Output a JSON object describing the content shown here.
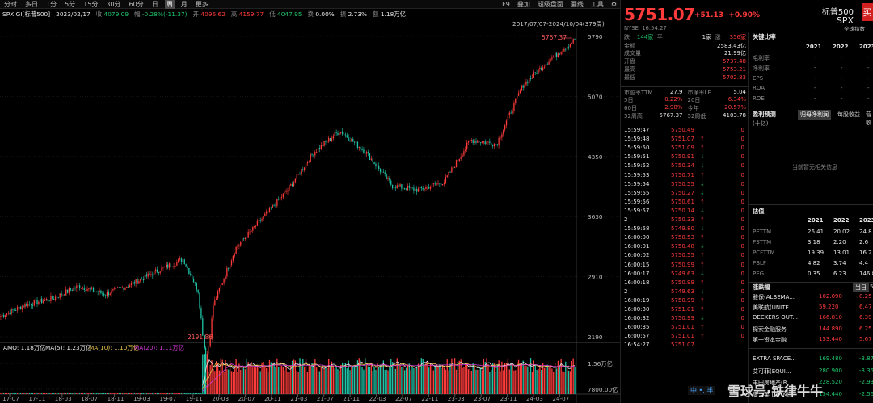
{
  "topbar": {
    "periods": [
      "分时",
      "多日",
      "1分",
      "5分",
      "15分",
      "30分",
      "60分",
      "日",
      "周",
      "月",
      "更多"
    ],
    "active_period": "周",
    "right_items": [
      "F9",
      "叠加",
      "超级盘面",
      "画线",
      "工具",
      "⚙"
    ]
  },
  "infobar": {
    "symbol": "SPX.GI[标普500]",
    "date": "2023/02/17",
    "close_label": "收",
    "close": "4079.09",
    "change_label": "幅",
    "change": "-0.28%(-11.37)",
    "open_label": "开",
    "open": "4096.62",
    "high_label": "高",
    "high": "4159.77",
    "low_label": "低",
    "low": "4047.95",
    "turnover_label": "换",
    "turnover": "0.00%",
    "amp_label": "振",
    "amp": "2.73%",
    "amount_label": "额",
    "amount": "1.18万亿"
  },
  "range": "2017/07/07-2024/10/04(379周)",
  "chart": {
    "price_axis": [
      "5790",
      "5070",
      "4350",
      "3630",
      "2910",
      "2190"
    ],
    "max_label": "5767.37",
    "min_label": "2191.86",
    "vol_axis": [
      "1.56万亿",
      "7800.00亿"
    ],
    "x_labels": [
      "17-07",
      "17-11",
      "18-03",
      "18-07",
      "18-11",
      "19-03",
      "19-07",
      "19-11",
      "20-03",
      "20-07",
      "20-11",
      "21-03",
      "21-07",
      "21-11",
      "22-03",
      "22-07",
      "22-11",
      "23-03",
      "23-07",
      "23-11",
      "24-03",
      "24-07"
    ],
    "vol_legend": {
      "amo": "AMO: 1.18万亿",
      "ma5": "MA(5): 1.23万亿",
      "ma10": "MA(10): 1.10万亿",
      "ma20": "MA(20): 1.11万亿"
    },
    "colors": {
      "up": "#ff3b3b",
      "down": "#1ec4a8",
      "ma5": "#e8e8e8",
      "ma10": "#e6c34a",
      "ma20": "#d23ad2"
    }
  },
  "chart_data": {
    "type": "candlestick",
    "series": [
      {
        "name": "SPX weekly close (approx)",
        "x": [
          "17-07",
          "17-11",
          "18-03",
          "18-07",
          "18-11",
          "19-03",
          "19-07",
          "19-11",
          "20-03",
          "20-07",
          "20-11",
          "21-03",
          "21-07",
          "21-11",
          "22-03",
          "22-07",
          "22-11",
          "23-03",
          "23-07",
          "23-11",
          "24-03",
          "24-07",
          "24-10"
        ],
        "values": [
          2440,
          2580,
          2650,
          2800,
          2700,
          2820,
          2980,
          3120,
          2450,
          3250,
          3600,
          3950,
          4400,
          4660,
          4400,
          4000,
          3950,
          4050,
          4550,
          4500,
          5200,
          5500,
          5751
        ]
      }
    ],
    "ylim": [
      2190,
      5790
    ]
  },
  "quote": {
    "price": "5751.07",
    "change": "+51.13",
    "pct": "+0.90%",
    "name": "标普500",
    "code": "SPX",
    "buy": "买",
    "index_label": "全球指数",
    "exchange": "NYSE",
    "time": "16:54:27",
    "breadth": {
      "up_label": "跌",
      "up": "144家",
      "flat_label": "平",
      "flat": "1家",
      "down_label": "涨",
      "down": "356家"
    },
    "rows": [
      {
        "k": "金额",
        "v": "2583.43亿",
        "c": "white"
      },
      {
        "k": "成交量",
        "v": "21.99亿",
        "c": "white"
      },
      {
        "k": "开盘",
        "v": "5737.48",
        "c": "red"
      },
      {
        "k": "最高",
        "v": "5753.21",
        "c": "red"
      },
      {
        "k": "最低",
        "v": "5702.83",
        "c": "red"
      }
    ],
    "val_rows": [
      {
        "k1": "市盈率TTM",
        "v1": "27.9",
        "k2": "市净率LF",
        "v2": "5.04",
        "c1": "white",
        "c2": "white"
      },
      {
        "k1": "5日",
        "v1": "0.22%",
        "k2": "20日",
        "v2": "6.34%",
        "c1": "red",
        "c2": "red"
      },
      {
        "k1": "60日",
        "v1": "2.98%",
        "k2": "今年",
        "v2": "20.57%",
        "c1": "red",
        "c2": "red"
      },
      {
        "k1": "52周高",
        "v1": "5767.37",
        "k2": "52周低",
        "v2": "4103.78",
        "c1": "white",
        "c2": "white"
      }
    ],
    "ticks": [
      {
        "t": "15:59:47",
        "p": "5750.49",
        "a": "",
        "v": "0",
        "c": "red"
      },
      {
        "t": "15:59:48",
        "p": "5751.07",
        "a": "↑",
        "v": "0",
        "c": "red"
      },
      {
        "t": "15:59:50",
        "p": "5751.09",
        "a": "↑",
        "v": "0",
        "c": "red"
      },
      {
        "t": "15:59:51",
        "p": "5750.91",
        "a": "↓",
        "v": "0",
        "c": "red"
      },
      {
        "t": "15:59:52",
        "p": "5750.34",
        "a": "↓",
        "v": "0",
        "c": "red"
      },
      {
        "t": "15:59:53",
        "p": "5750.71",
        "a": "↑",
        "v": "0",
        "c": "red"
      },
      {
        "t": "15:59:54",
        "p": "5750.55",
        "a": "↓",
        "v": "0",
        "c": "red"
      },
      {
        "t": "15:59:55",
        "p": "5750.27",
        "a": "↓",
        "v": "0",
        "c": "red"
      },
      {
        "t": "15:59:56",
        "p": "5750.61",
        "a": "↑",
        "v": "0",
        "c": "red"
      },
      {
        "t": "15:59:57",
        "p": "5750.14",
        "a": "↓",
        "v": "0",
        "c": "red"
      },
      {
        "t": "2",
        "p": "5750.33",
        "a": "↑",
        "v": "0",
        "c": "red"
      },
      {
        "t": "15:59:58",
        "p": "5749.80",
        "a": "↓",
        "v": "0",
        "c": "red"
      },
      {
        "t": "16:00:00",
        "p": "5750.53",
        "a": "↑",
        "v": "0",
        "c": "red"
      },
      {
        "t": "16:00:01",
        "p": "5750.48",
        "a": "↓",
        "v": "0",
        "c": "red"
      },
      {
        "t": "16:00:02",
        "p": "5750.55",
        "a": "↑",
        "v": "0",
        "c": "red"
      },
      {
        "t": "16:00:15",
        "p": "5750.99",
        "a": "↑",
        "v": "0",
        "c": "red"
      },
      {
        "t": "16:00:17",
        "p": "5749.63",
        "a": "↓",
        "v": "0",
        "c": "red"
      },
      {
        "t": "16:00:18",
        "p": "5750.99",
        "a": "↑",
        "v": "0",
        "c": "red"
      },
      {
        "t": "2",
        "p": "5749.63",
        "a": "↓",
        "v": "0",
        "c": "red"
      },
      {
        "t": "16:00:19",
        "p": "5750.99",
        "a": "↑",
        "v": "0",
        "c": "red"
      },
      {
        "t": "16:00:30",
        "p": "5751.01",
        "a": "↑",
        "v": "0",
        "c": "red"
      },
      {
        "t": "16:00:32",
        "p": "5750.99",
        "a": "↓",
        "v": "0",
        "c": "red"
      },
      {
        "t": "16:00:35",
        "p": "5751.01",
        "a": "↑",
        "v": "0",
        "c": "red"
      },
      {
        "t": "16:00:57",
        "p": "5751.01",
        "a": "↑",
        "v": "0",
        "c": "red"
      },
      {
        "t": "16:54:27",
        "p": "5751.07",
        "a": "",
        "v": "",
        "c": "red"
      }
    ]
  },
  "fin": {
    "title": "关键比率",
    "years": [
      "2021",
      "2022",
      "2023"
    ],
    "rows": [
      {
        "k": "毛利率",
        "v": [
          "-",
          "-",
          "-"
        ]
      },
      {
        "k": "净利率",
        "v": [
          "-",
          "-",
          "-"
        ]
      },
      {
        "k": "EPS",
        "v": [
          "-",
          "-",
          "-"
        ]
      },
      {
        "k": "ROA",
        "v": [
          "-",
          "-",
          "-"
        ]
      },
      {
        "k": "ROE",
        "v": [
          "-",
          "-",
          "-"
        ]
      }
    ],
    "forecast_title": "盈利预测",
    "tab1": "归母净利润",
    "tab2": "每股收益",
    "tab3": "营收",
    "unit": "(十亿)",
    "empty": "当前暂无相关信息",
    "val_title": "估值",
    "val_years": [
      "2021",
      "2022",
      "2023"
    ],
    "val_rows": [
      {
        "k": "PETTM",
        "v": [
          "26.41",
          "20.02",
          "24.8"
        ]
      },
      {
        "k": "PSTTM",
        "v": [
          "3.18",
          "2.20",
          "2.6"
        ]
      },
      {
        "k": "PCFTTM",
        "v": [
          "19.39",
          "13.01",
          "16.2"
        ]
      },
      {
        "k": "PBLF",
        "v": [
          "4.82",
          "3.74",
          "4.4"
        ]
      },
      {
        "k": "PEG",
        "v": [
          "0.35",
          "6.23",
          "146.8"
        ]
      }
    ],
    "movers_title": "涨跌幅",
    "movers_today": "当日",
    "movers_5": "5m",
    "movers": [
      {
        "k": "雅保(ALBEMA...",
        "p": "102.090",
        "c": "8.25"
      },
      {
        "k": "美联航(UNITE...",
        "p": "59.220",
        "c": "6.47"
      },
      {
        "k": "DECKERS OUT...",
        "p": "166.810",
        "c": "6.39"
      },
      {
        "k": "探索金融服务",
        "p": "144.890",
        "c": "6.25"
      },
      {
        "k": "第一资本金融",
        "p": "153.440",
        "c": "5.67"
      }
    ],
    "losers": [
      {
        "k": "EXTRA SPACE...",
        "p": "169.480",
        "c": "-3.87"
      },
      {
        "k": "艾可菲(EQUI...",
        "p": "280.900",
        "c": "-3.35"
      },
      {
        "k": "丰田房地产(R...",
        "p": "228.520",
        "c": "-2.93"
      },
      {
        "k": "康宝莱工业(M...",
        "p": "154.440",
        "c": "-2.56"
      }
    ]
  },
  "watermark": "雪球号·铁律牛牛",
  "ime": "中 •, 半"
}
